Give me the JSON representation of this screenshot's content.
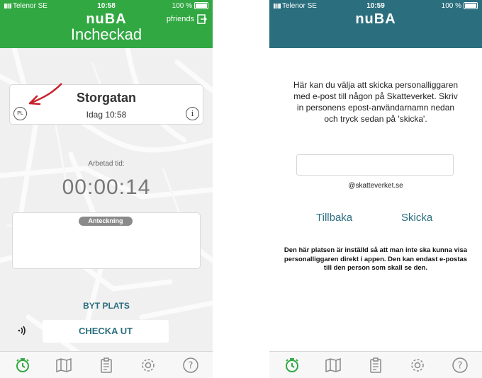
{
  "left": {
    "status_bar": {
      "carrier": "Telenor SE",
      "time": "10:58",
      "battery": "100 %"
    },
    "header": {
      "logo": "nuBA",
      "status": "Incheckad",
      "user": "pfriends"
    },
    "location": {
      "name": "Storgatan",
      "time": "Idag 10:58",
      "badge": "PL"
    },
    "work": {
      "label": "Arbetad tid:",
      "timer": "00:00:14"
    },
    "note": {
      "label": "Anteckning"
    },
    "change_place": "BYT PLATS",
    "checkout": "CHECKA UT"
  },
  "right": {
    "status_bar": {
      "carrier": "Telenor SE",
      "time": "10:59",
      "battery": "100 %"
    },
    "header": {
      "logo": "nuBA"
    },
    "instructions": "Här kan du välja att skicka personalliggaren med e-post till någon på Skatteverket. Skriv in personens epost-användarnamn nedan och tryck sedan på 'skicka'.",
    "email": {
      "value": "",
      "domain": "@skatteverket.se"
    },
    "back": "Tillbaka",
    "send": "Skicka",
    "warning": "Den här platsen är inställd så att man inte ska kunna visa personalliggaren direkt i appen. Den kan endast e-postas till den person som skall se den."
  },
  "tabs": [
    "clock-icon",
    "map-icon",
    "clipboard-icon",
    "gear-icon",
    "help-icon"
  ],
  "colors": {
    "green": "#31a842",
    "teal": "#2b6f7e",
    "accent": "#2a6e7f",
    "arrow": "#c8202b"
  }
}
